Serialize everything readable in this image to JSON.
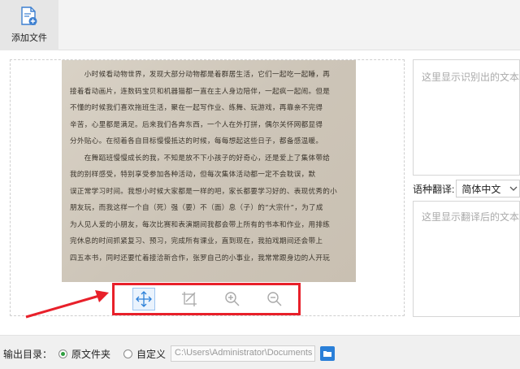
{
  "toolbar": {
    "add_file_label": "添加文件"
  },
  "document": {
    "lines": [
      "　　小时候看动物世界，发现大部分动物都是着群居生活，它们一起吃一起睡，再",
      "接着看动画片，连数码宝贝和机器猫都一直在主人身边陪伴，一起疯一起闹。但是",
      "不懂的时候我们喜欢拖班生活，聚在一起写作业、练舞、玩游戏，再靠亲不完得",
      "辛苦，心里都是满足。后来我们各奔东西，一个人在外打拼，偶尔关怀网都显得",
      "分外贴心。在彻着各自目标慢慢抵达的时候，每每想起这些日子，都备感温暖。",
      "　　在舞蹈班慢慢成长的我，不知是放不下小孩子的好奇心，还是爱上了集体带给",
      "我的别样感受，特别享受参加各种活动，但每次集体活动都一定不会耽误，默",
      "误正常学习时间。我想小时候大家都是一样的吧，家长都要学习好的、表现优秀的小",
      "朋友玩，而我这样一个自（死）强（要）不（面）息（子）的“大宗什”，为了成",
      "为人见人爱的小朋友，每次比赛和表演期间我都会带上所有的书本和作业，用排练",
      "完休息的时间抓紧复习、预习，完成所有课业，直到现在，我拍戏期间还会带上",
      "四五本书，同时还要忙着接洽新合作，张罗自己的小事业，我常常跟身边的人开玩"
    ]
  },
  "tools": {
    "move": "move-icon",
    "crop": "crop-icon",
    "zoom_in": "zoom-in-icon",
    "zoom_out": "zoom-out-icon"
  },
  "ocr": {
    "placeholder": "这里显示识别出的文本"
  },
  "translation": {
    "label": "语种翻译:",
    "selected_language": "简体中文",
    "placeholder": "这里显示翻译后的文本"
  },
  "output": {
    "label": "输出目录：",
    "option_original": "原文件夹",
    "option_custom": "自定义",
    "path_placeholder": "C:\\Users\\Administrator\\Documents",
    "original_checked": true
  },
  "colors": {
    "highlight_red": "#e8202a",
    "accent_blue": "#2a7fd8",
    "radio_green": "#2e9e3f"
  }
}
